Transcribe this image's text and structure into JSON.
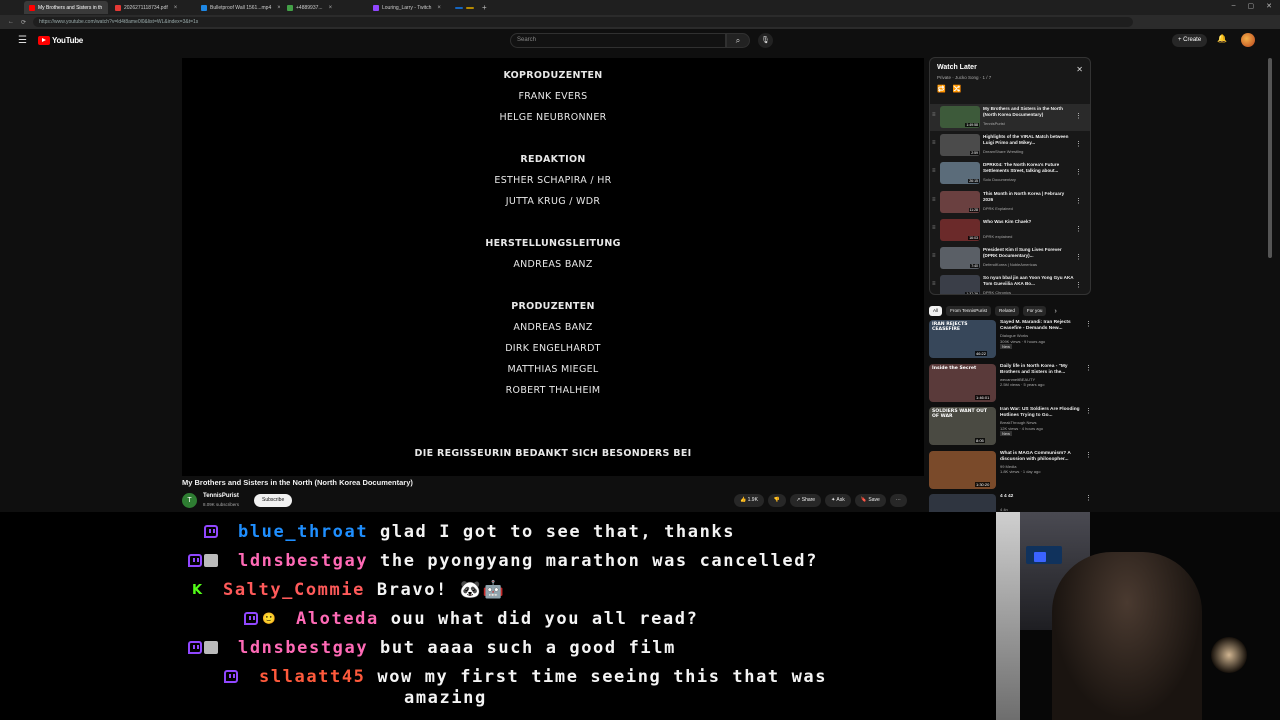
{
  "browser": {
    "tabs": [
      {
        "label": "My Brothers and Sisters in th",
        "active": true,
        "color": "#ff0000"
      },
      {
        "label": "2026271118734.pdf",
        "active": false,
        "color": "#e53935"
      },
      {
        "label": "Bulletproof Wall 1561...mp4",
        "active": false,
        "color": "#1e88e5"
      },
      {
        "label": "+4889937... ",
        "active": false,
        "color": "#43a047"
      },
      {
        "label": "Louring_Larry - Twitch",
        "active": false,
        "color": "#9147ff"
      }
    ],
    "url": "https://www.youtube.com/watch?v=ld4t8ame0l0&list=WL&index=3&t=1s"
  },
  "youtube": {
    "logo_text": "YouTube",
    "search_placeholder": "Search",
    "create_label": "+ Create",
    "player": {
      "credits": [
        {
          "kind": "heading",
          "text": "KOPRODUZENTEN"
        },
        {
          "kind": "name",
          "text": "FRANK EVERS"
        },
        {
          "kind": "name",
          "text": "HELGE NEUBRONNER"
        },
        {
          "kind": "heading",
          "text": "REDAKTION"
        },
        {
          "kind": "name",
          "text": "ESTHER SCHAPIRA / HR"
        },
        {
          "kind": "name",
          "text": "JUTTA KRUG / WDR"
        },
        {
          "kind": "heading",
          "text": "HERSTELLUNGSLEITUNG"
        },
        {
          "kind": "name",
          "text": "ANDREAS BANZ"
        },
        {
          "kind": "heading",
          "text": "PRODUZENTEN"
        },
        {
          "kind": "name",
          "text": "ANDREAS BANZ"
        },
        {
          "kind": "name",
          "text": "DIRK ENGELHARDT"
        },
        {
          "kind": "name",
          "text": "MATTHIAS MIEGEL"
        },
        {
          "kind": "name",
          "text": "ROBERT THALHEIM"
        },
        {
          "kind": "heading",
          "text": "DIE REGISSEURIN BEDANKT SICH BESONDERS BEI"
        }
      ]
    },
    "video": {
      "title": "My Brothers and Sisters in the North (North Korea Documentary)",
      "channel": "TennisPurist",
      "channel_initial": "T",
      "subscribers": "8.09K subscribers",
      "subscribe_label": "Subscribe",
      "likes": "1.9K",
      "share_label": "Share",
      "ask_label": "Ask",
      "save_label": "Save"
    },
    "watch_later": {
      "title": "Watch Later",
      "subtitle": "Private · Jucko Song · 1 / 7",
      "items": [
        {
          "title": "My Brothers and Sisters in the North (North Korea Documentary)",
          "channel": "TennisPurist",
          "duration": "1:49:58",
          "thumb": "#3d5a3a"
        },
        {
          "title": "Highlights of the VIRAL Match between Luigi Primo and Mikey...",
          "channel": "DreamShare Wrestling",
          "duration": "2:59",
          "thumb": "#4b4b4b"
        },
        {
          "title": "DPRK04: The North Korea's Future Settlements Street, talking about...",
          "channel": "Solo Documentary",
          "duration": "26:15",
          "thumb": "#5b6c7a"
        },
        {
          "title": "This Month in North Korea | February 2026",
          "channel": "DPRK Explained",
          "duration": "11:28",
          "thumb": "#6a4040"
        },
        {
          "title": "Who Was Kim Chaek?",
          "channel": "DPRK explained",
          "duration": "16:03",
          "thumb": "#6b2a2a"
        },
        {
          "title": "President Kim Il Sung Lives Forever (DPRK Documentary)...",
          "channel": "DefendKorea | NobleAmericas",
          "duration": "7:40",
          "thumb": "#5a5f66"
        },
        {
          "title": "So nyun bbal jin aan Yoon Yong Gyu AKA Tom Gueviilia AKA Bo...",
          "channel": "DPRK Chronics",
          "duration": "1:37:29",
          "thumb": "#3a3e48"
        }
      ]
    },
    "chips": [
      "All",
      "From TennisPurist",
      "Related",
      "For you"
    ],
    "recommended": [
      {
        "title": "Sayed M. Marandi: Iran Rejects Ceasefire - Demands New...",
        "meta": [
          "Dialogue Works",
          "309K views · 9 hours ago"
        ],
        "duration": "46:22",
        "overlay": "IRAN REJECTS CEASEFIRE",
        "thumb": "#37475a",
        "badge": "New"
      },
      {
        "title": "Daily life in North Korea - \"My Brothers and Sisters in the...",
        "meta": [
          "wecanmeltBEAUTY",
          "2.5M views · 5 years ago"
        ],
        "duration": "1:46:01",
        "overlay": "Inside the Secret",
        "thumb": "#5a3a3a",
        "badge": ""
      },
      {
        "title": "Iran War: US Soldiers Are Flooding Hotlines Trying to Go...",
        "meta": [
          "BreakThrough News",
          "12K views · 4 hours ago"
        ],
        "duration": "8:05",
        "overlay": "SOLDIERS WANT OUT OF WAR",
        "thumb": "#4a4a42",
        "badge": "New"
      },
      {
        "title": "What is MAGA Communism? A discussion with philosopher...",
        "meta": [
          "99 Media",
          "1.8K views · 1 day ago"
        ],
        "duration": "1:30:20",
        "overlay": "",
        "thumb": "#7a4a2a",
        "badge": ""
      },
      {
        "title": "4 4 42",
        "meta": [
          "4 4n"
        ],
        "duration": "",
        "overlay": "",
        "thumb": "#2f3540",
        "badge": ""
      }
    ]
  },
  "chat": {
    "messages": [
      {
        "user": "blue_throat",
        "color": "#1f8fff",
        "text": "glad I got to see that, thanks",
        "badges": [
          "twitch"
        ]
      },
      {
        "user": "ldnsbestgay",
        "color": "#ff6ab6",
        "text": "the pyongyang marathon was cancelled?",
        "badges": [
          "twitch",
          "bot"
        ]
      },
      {
        "user": "Salty_Commie",
        "color": "#ff5a5a",
        "text": "Bravo! 🐼🤖",
        "badges": [
          "kick"
        ]
      },
      {
        "user": "Aloteda",
        "color": "#ff6ab6",
        "text": "ouu what did you all read?",
        "badges": [
          "twitch",
          "emoji"
        ]
      },
      {
        "user": "ldnsbestgay",
        "color": "#ff6ab6",
        "text": "but aaaa such a good film",
        "badges": [
          "twitch",
          "bot"
        ]
      },
      {
        "user": "sllaatt45",
        "color": "#ff5a3c",
        "text": "wow my first time seeing this that was",
        "text2": "amazing",
        "badges": [
          "twitch"
        ]
      }
    ]
  }
}
